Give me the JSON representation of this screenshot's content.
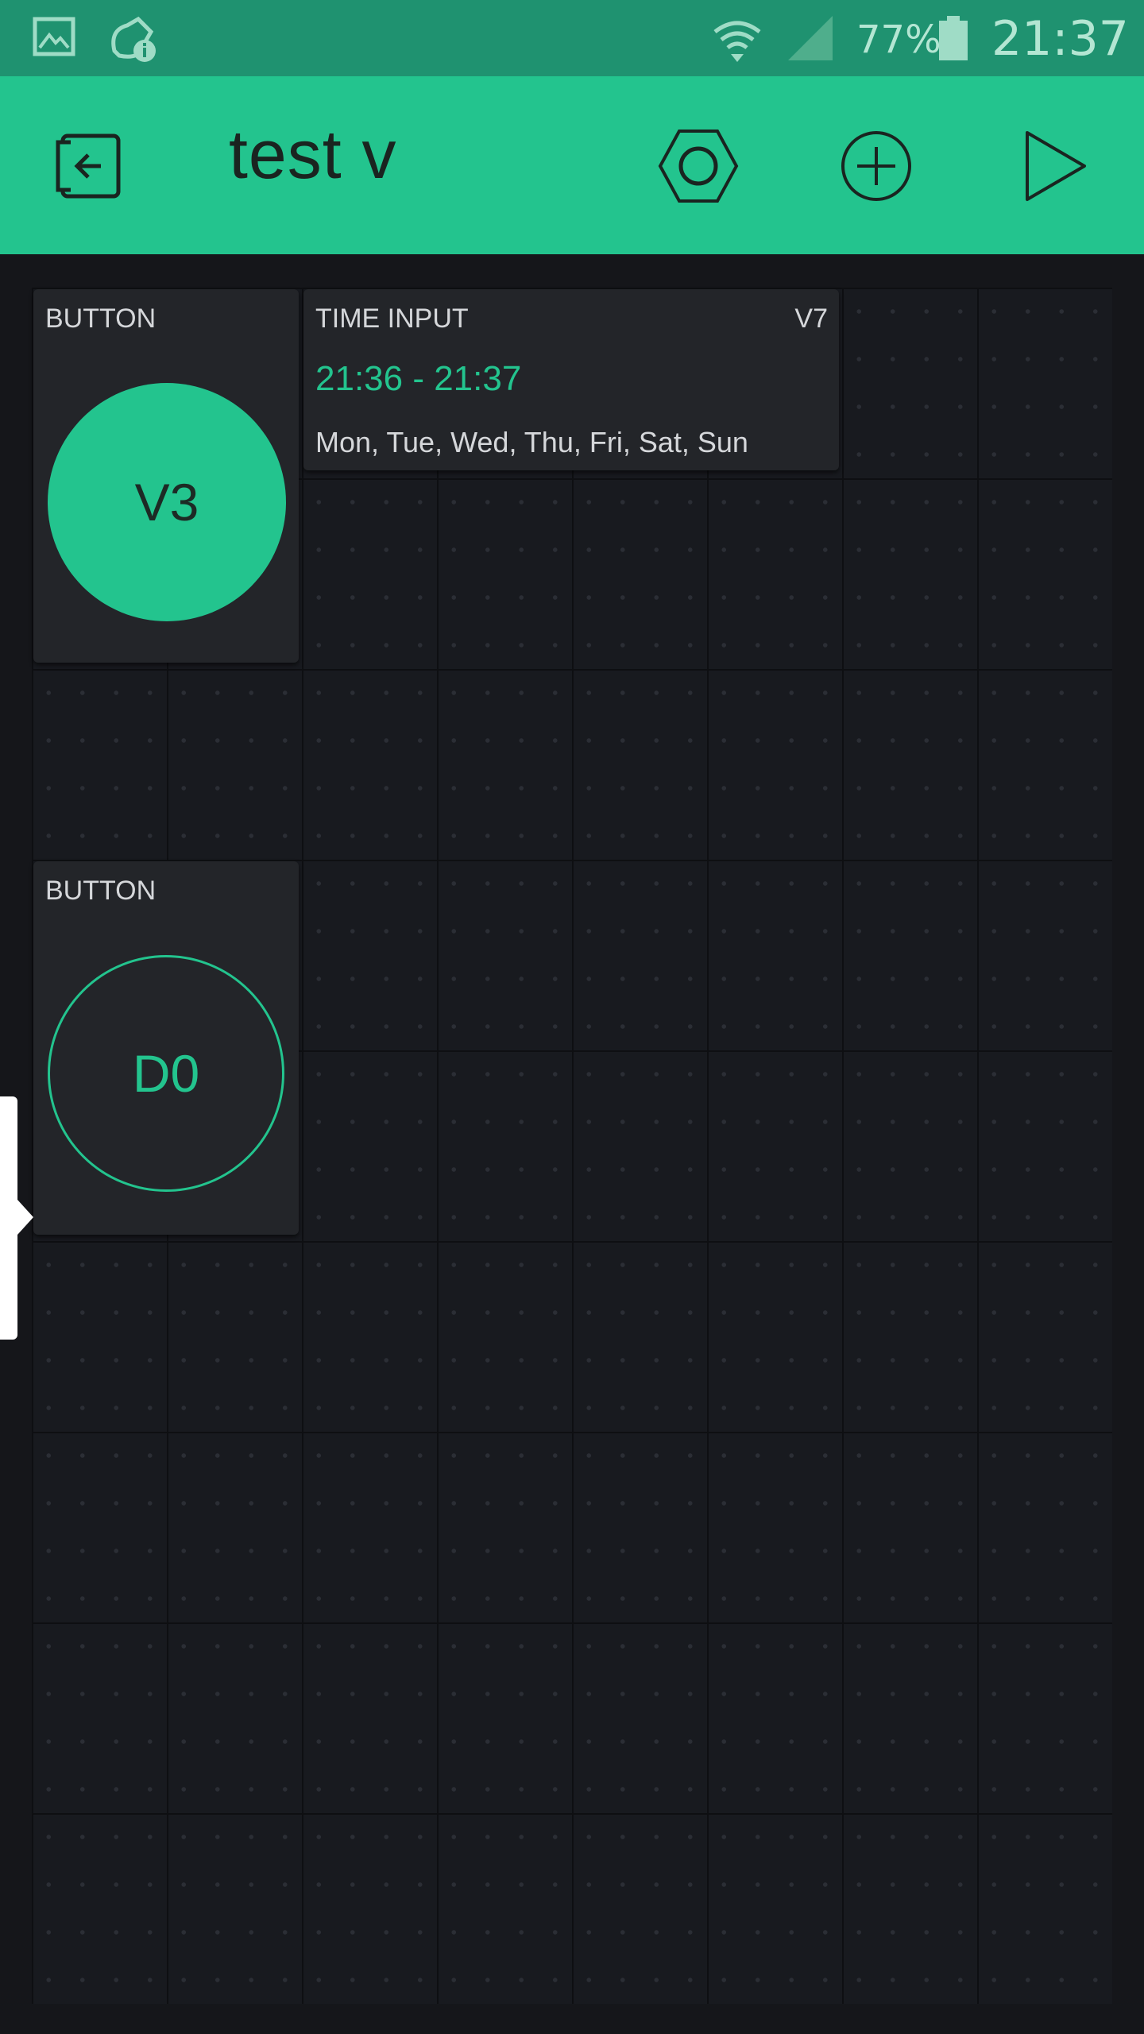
{
  "status_bar": {
    "battery": "77%",
    "time": "21:37",
    "icons": [
      "gallery-icon",
      "notification-icon",
      "wifi-icon",
      "signal-icon",
      "battery-icon"
    ]
  },
  "app_bar": {
    "title": "test v",
    "icons": [
      "exit-project-icon",
      "settings-hexagon-icon",
      "add-widget-icon",
      "play-icon"
    ],
    "accent": "#23c48e"
  },
  "widgets": {
    "button1": {
      "label": "BUTTON",
      "pin": "V3",
      "state": "on"
    },
    "time_input": {
      "label": "TIME INPUT",
      "pin": "V7",
      "range": "21:36 - 21:37",
      "days": "Mon, Tue, Wed, Thu, Fri, Sat, Sun"
    },
    "button2": {
      "label": "BUTTON",
      "pin": "D0",
      "state": "off"
    }
  },
  "colors": {
    "background": "#15161a",
    "widget": "#232529",
    "accent": "#23c48e",
    "status_bar": "#1f9270"
  }
}
